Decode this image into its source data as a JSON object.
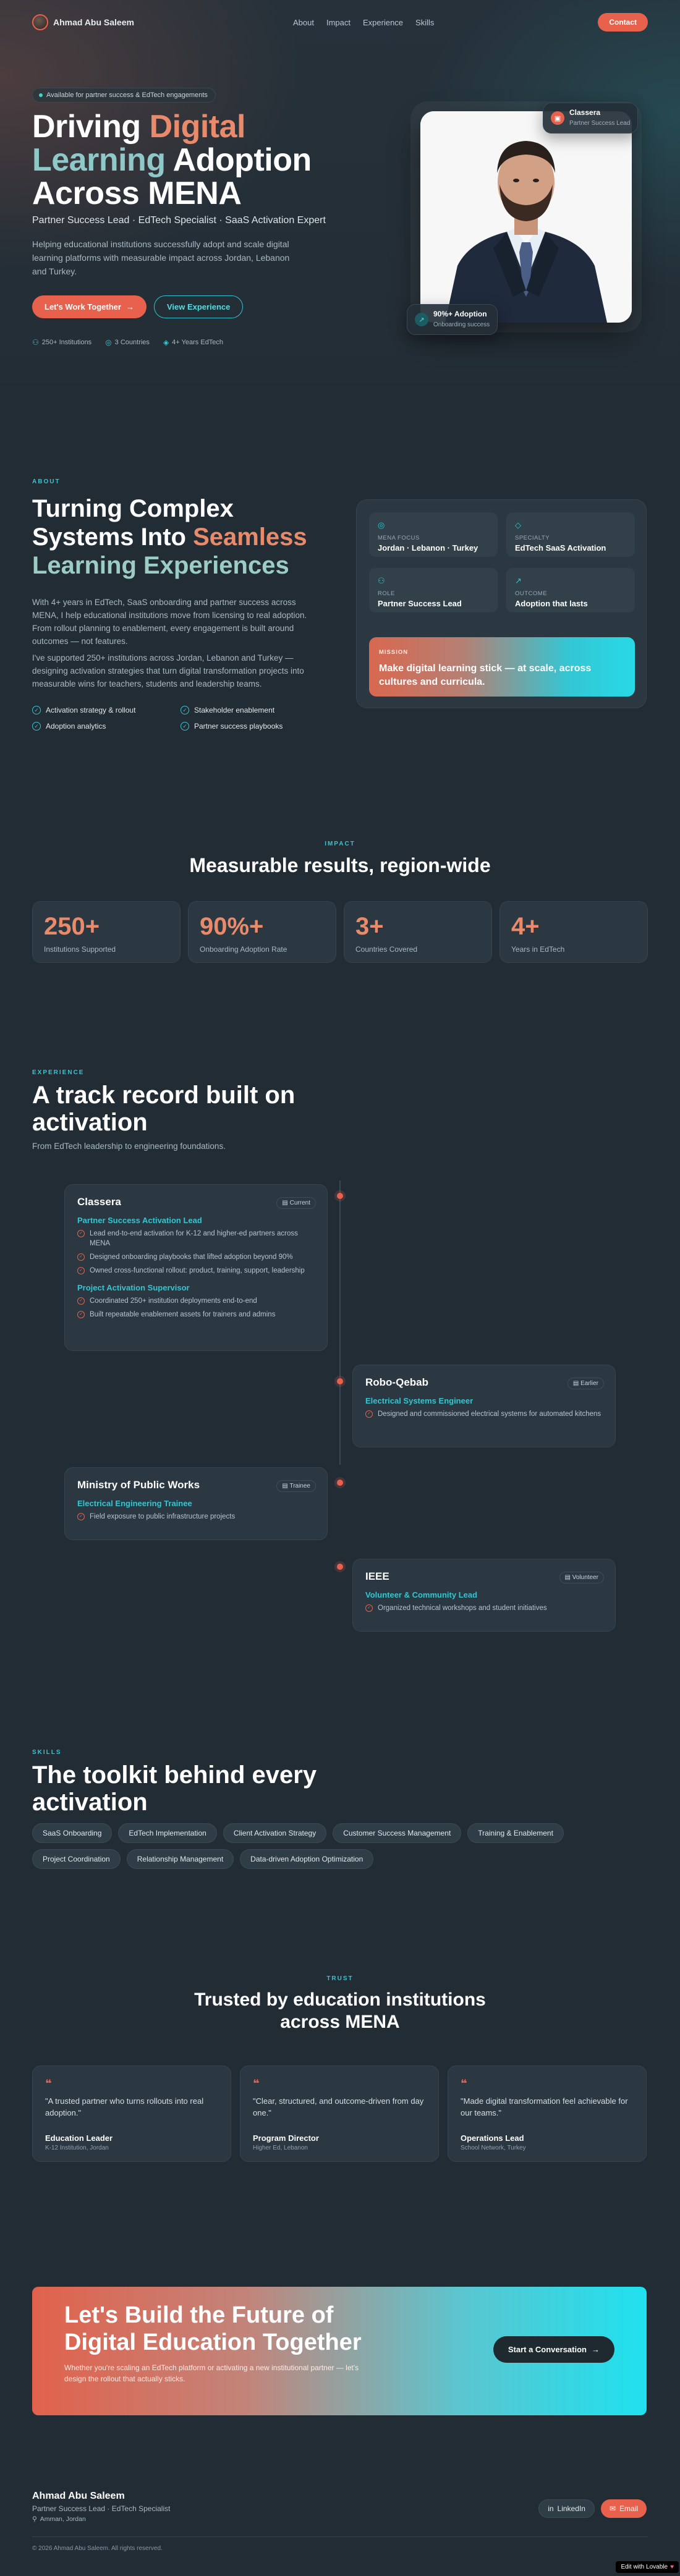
{
  "nav": {
    "brand": "Ahmad Abu Saleem",
    "links": [
      "About",
      "Impact",
      "Experience",
      "Skills"
    ],
    "contact": "Contact"
  },
  "hero": {
    "pill": "Available for partner success & EdTech engagements",
    "title_a": "Driving ",
    "title_b": "Digital",
    "title_c": "Learning",
    "title_d": " Adoption",
    "title_e": "Across MENA",
    "subtitle": "Partner Success Lead · EdTech Specialist · SaaS Activation Expert",
    "description": "Helping educational institutions successfully adopt and scale digital learning platforms with measurable impact across Jordan, Lebanon and Turkey.",
    "cta_primary": "Let's Work Together",
    "cta_secondary": "View Experience",
    "stats": [
      "250+ Institutions",
      "3 Countries",
      "4+ Years EdTech"
    ],
    "float_top_title": "Classera",
    "float_top_sub": "Partner Success Lead",
    "float_bottom_title": "90%+ Adoption",
    "float_bottom_sub": "Onboarding success"
  },
  "about": {
    "eyebrow": "ABOUT",
    "title_a": "Turning Complex Systems Into ",
    "title_b": "Seamless",
    "title_c": "Learning",
    "title_d": " Experiences",
    "para1": "With 4+ years in EdTech, SaaS onboarding and partner success across MENA, I help educational institutions move from licensing to real adoption. From rollout planning to enablement, every engagement is built around outcomes — not features.",
    "para2": "I've supported 250+ institutions across Jordan, Lebanon and Turkey — designing activation strategies that turn digital transformation projects into measurable wins for teachers, students and leadership teams.",
    "checks": [
      "Activation strategy & rollout",
      "Stakeholder enablement",
      "Adoption analytics",
      "Partner success playbooks"
    ],
    "cells": [
      {
        "label": "MENA FOCUS",
        "value": "Jordan · Lebanon · Turkey"
      },
      {
        "label": "SPECIALTY",
        "value": "EdTech SaaS Activation"
      },
      {
        "label": "ROLE",
        "value": "Partner Success Lead"
      },
      {
        "label": "OUTCOME",
        "value": "Adoption that lasts"
      }
    ],
    "mission_label": "MISSION",
    "mission_text": "Make digital learning stick — at scale, across cultures and curricula."
  },
  "impact": {
    "eyebrow": "IMPACT",
    "title": "Measurable results, region-wide",
    "stats": [
      {
        "value": "250+",
        "label": "Institutions Supported"
      },
      {
        "value": "90%+",
        "label": "Onboarding Adoption Rate"
      },
      {
        "value": "3+",
        "label": "Countries Covered"
      },
      {
        "value": "4+",
        "label": "Years in EdTech"
      }
    ]
  },
  "experience": {
    "eyebrow": "EXPERIENCE",
    "title": "A track record built on activation",
    "subtitle": "From EdTech leadership to engineering foundations.",
    "items": [
      {
        "company": "Classera",
        "tag": "Current",
        "role1": "Partner Success Activation Lead",
        "b1": "Lead end-to-end activation for K-12 and higher-ed partners across MENA",
        "b2": "Designed onboarding playbooks that lifted adoption beyond 90%",
        "b3": "Owned cross-functional rollout: product, training, support, leadership",
        "role2": "Project Activation Supervisor",
        "b4": "Coordinated 250+ institution deployments end-to-end",
        "b5": "Built repeatable enablement assets for trainers and admins"
      },
      {
        "company": "Robo-Qebab",
        "tag": "Earlier",
        "role1": "Electrical Systems Engineer",
        "b1": "Designed and commissioned electrical systems for automated kitchens"
      },
      {
        "company": "Ministry of Public Works",
        "tag": "Trainee",
        "role1": "Electrical Engineering Trainee",
        "b1": "Field exposure to public infrastructure projects"
      },
      {
        "company": "IEEE",
        "tag": "Volunteer",
        "role1": "Volunteer & Community Lead",
        "b1": "Organized technical workshops and student initiatives"
      }
    ]
  },
  "skills": {
    "eyebrow": "SKILLS",
    "title": "The toolkit behind every activation",
    "chips": [
      "SaaS Onboarding",
      "EdTech Implementation",
      "Client Activation Strategy",
      "Customer Success Management",
      "Training & Enablement",
      "Project Coordination",
      "Relationship Management",
      "Data-driven Adoption Optimization"
    ]
  },
  "trust": {
    "eyebrow": "TRUST",
    "title": "Trusted by education institutions across MENA",
    "quotes": [
      {
        "text": "\"A trusted partner who turns rollouts into real adoption.\"",
        "name": "Education Leader",
        "org": "K-12 Institution, Jordan"
      },
      {
        "text": "\"Clear, structured, and outcome-driven from day one.\"",
        "name": "Program Director",
        "org": "Higher Ed, Lebanon"
      },
      {
        "text": "\"Made digital transformation feel achievable for our teams.\"",
        "name": "Operations Lead",
        "org": "School Network, Turkey"
      }
    ]
  },
  "cta": {
    "title": "Let's Build the Future of Digital Education Together",
    "text": "Whether you're scaling an EdTech platform or activating a new institutional partner — let's design the rollout that actually sticks.",
    "button": "Start a Conversation"
  },
  "footer": {
    "name": "Ahmad Abu Saleem",
    "role": "Partner Success Lead · EdTech Specialist",
    "location": "Amman, Jordan",
    "linkedin": "LinkedIn",
    "email": "Email",
    "copyright": "© 2026 Ahmad Abu Saleem. All rights reserved.",
    "badge": "Edit with Lovable"
  }
}
